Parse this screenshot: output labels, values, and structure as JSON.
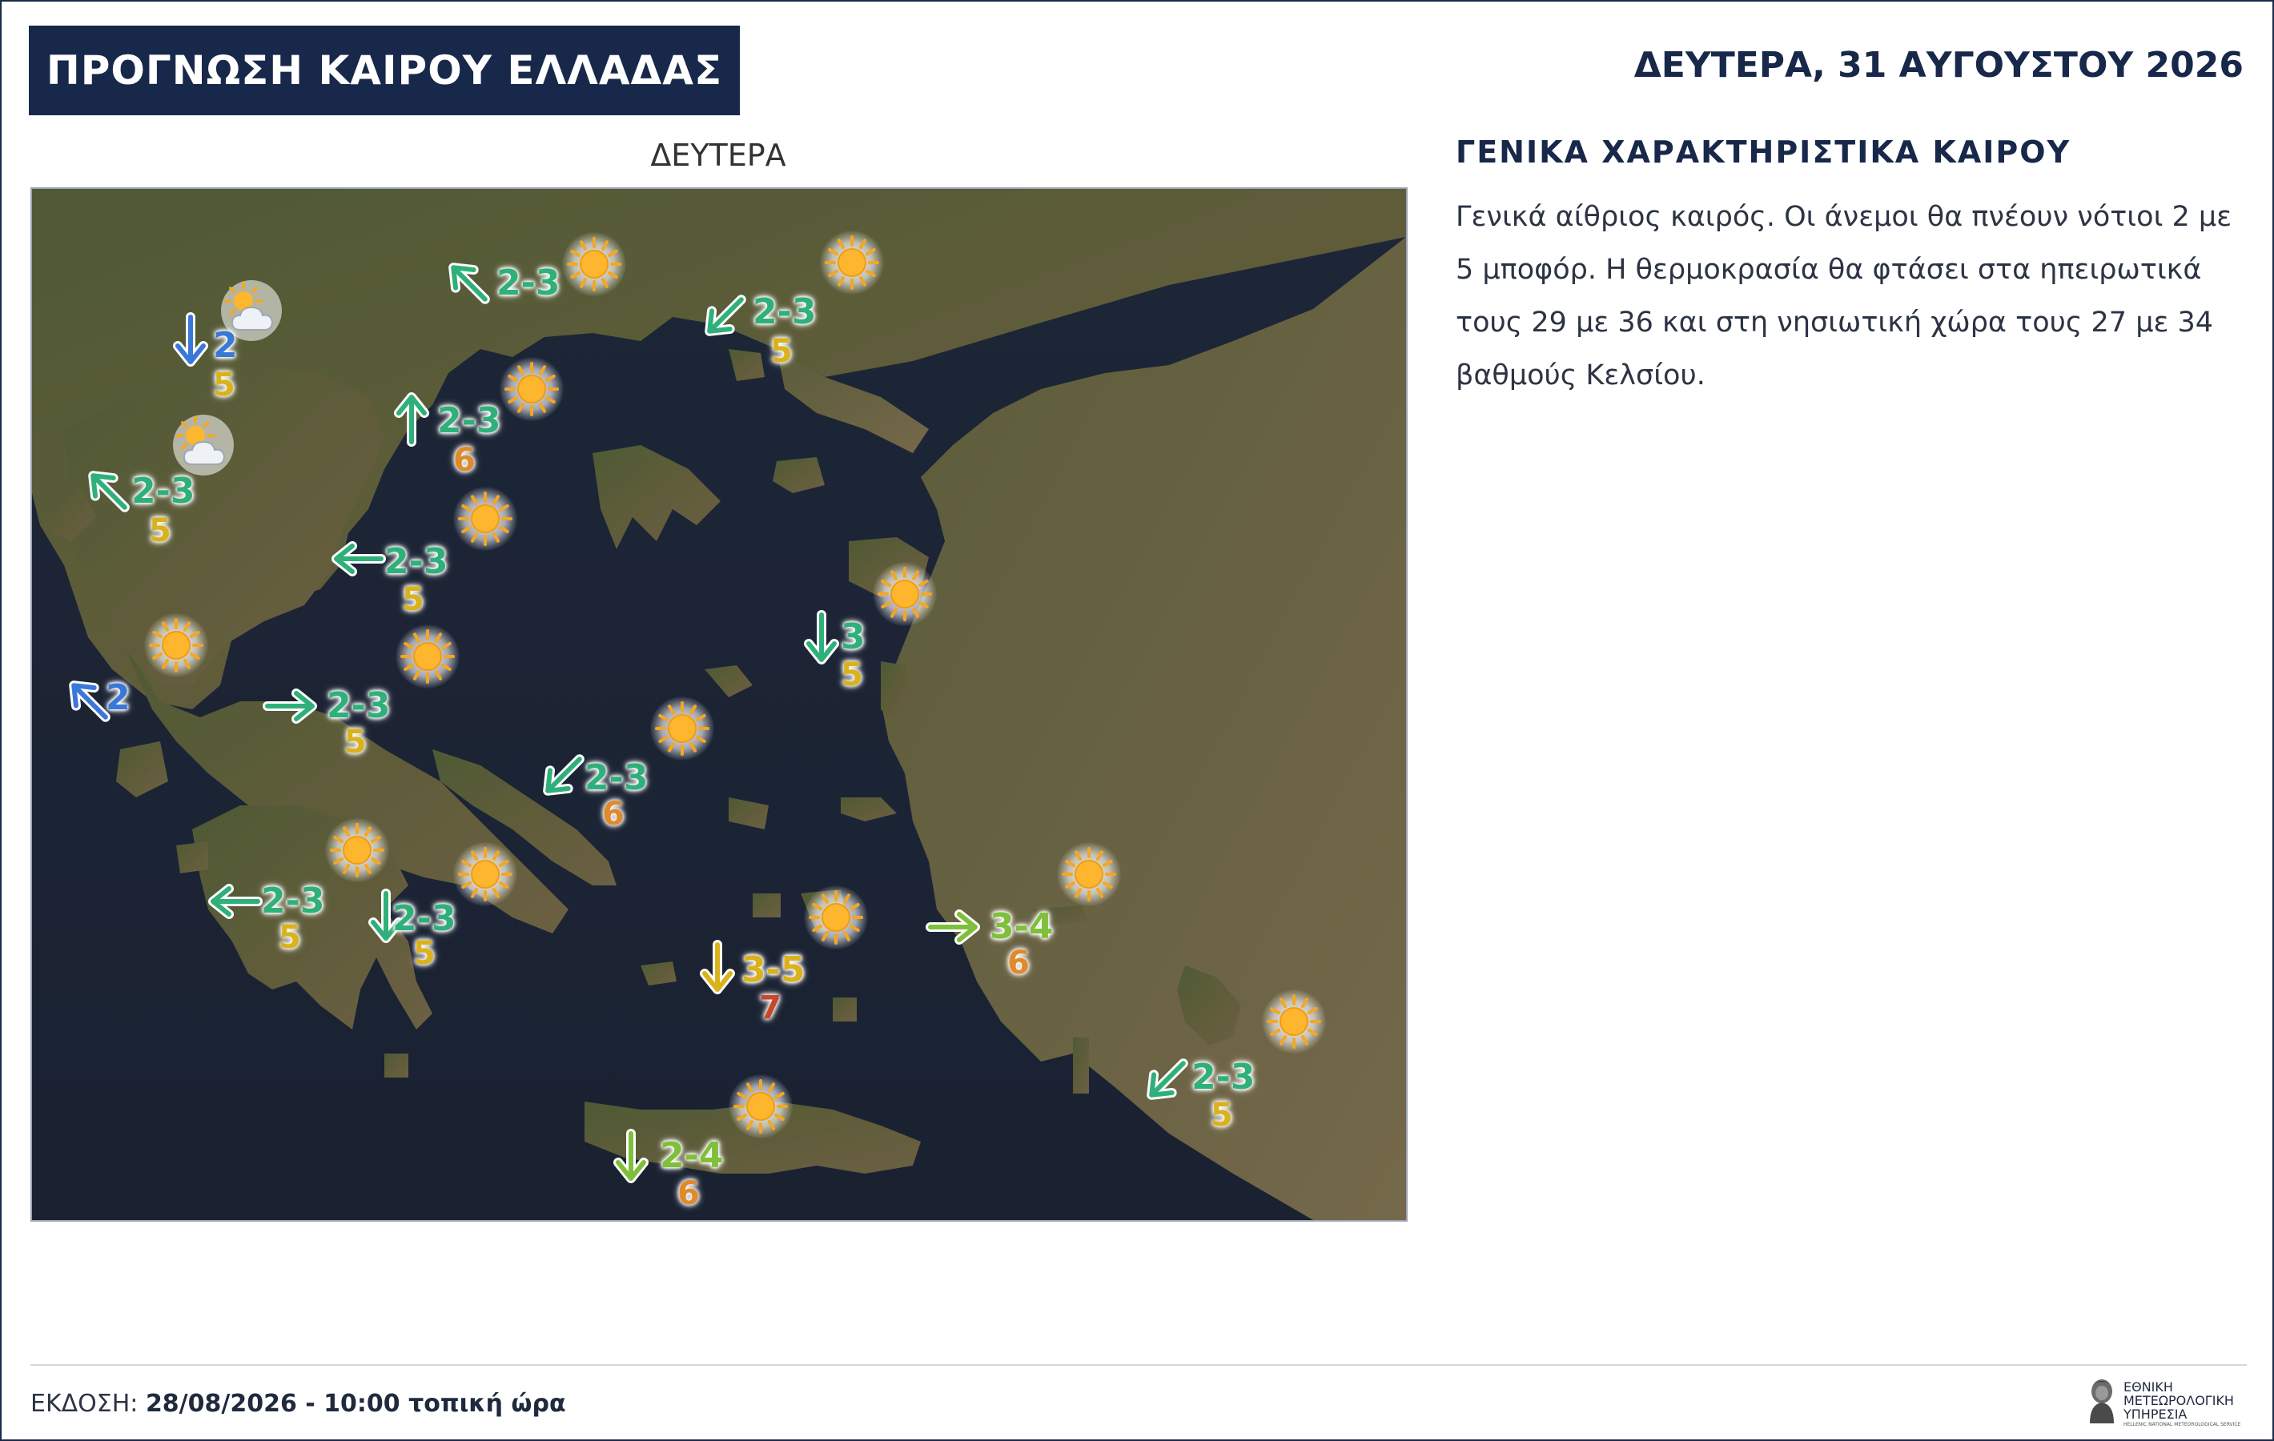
{
  "header": {
    "title": "ΠΡΟΓΝΩΣΗ ΚΑΙΡΟΥ ΕΛΛΑΔΑΣ",
    "date": "ΔΕΥΤΕΡΑ, 31 ΑΥΓΟΥΣΤΟΥ 2026"
  },
  "map": {
    "label": "ΔΕΥΤΕΡΑ",
    "colors": {
      "wind_green": "#2fb07a",
      "wind_blue": "#3a78d8",
      "wind_lime": "#7fbf3a",
      "wind_yellow": "#d9b21c",
      "temp_5": "#d9b21c",
      "temp_6": "#e08a2a",
      "temp_7": "#c9472a"
    },
    "stations": [
      {
        "weather": "sun-icon",
        "wind_dir": "NW",
        "wind_color": "#2fb07a",
        "beaufort": "2-3",
        "temp": ""
      },
      {
        "weather": "sun-icon",
        "wind_dir": "SW",
        "wind_color": "#2fb07a",
        "beaufort": "2-3",
        "temp": "5"
      },
      {
        "weather": "partly-cloudy-icon",
        "wind_dir": "S",
        "wind_color": "#3a78d8",
        "beaufort": "2",
        "temp": "5"
      },
      {
        "weather": "sun-icon",
        "wind_dir": "N",
        "wind_color": "#2fb07a",
        "beaufort": "2-3",
        "temp": "6"
      },
      {
        "weather": "partly-cloudy-icon",
        "wind_dir": "NW",
        "wind_color": "#2fb07a",
        "beaufort": "2-3",
        "temp": "5"
      },
      {
        "weather": "sun-icon",
        "wind_dir": "W",
        "wind_color": "#2fb07a",
        "beaufort": "2-3",
        "temp": "5"
      },
      {
        "weather": "sun-icon",
        "wind_dir": "S",
        "wind_color": "#2fb07a",
        "beaufort": "3",
        "temp": "5"
      },
      {
        "weather": "sun-icon",
        "wind_dir": "NW",
        "wind_color": "#3a78d8",
        "beaufort": "2",
        "temp": ""
      },
      {
        "weather": "sun-icon",
        "wind_dir": "E",
        "wind_color": "#2fb07a",
        "beaufort": "2-3",
        "temp": "5"
      },
      {
        "weather": "sun-icon",
        "wind_dir": "SW",
        "wind_color": "#2fb07a",
        "beaufort": "2-3",
        "temp": "6"
      },
      {
        "weather": "sun-icon",
        "wind_dir": "W",
        "wind_color": "#2fb07a",
        "beaufort": "2-3",
        "temp": "5"
      },
      {
        "weather": "sun-icon",
        "wind_dir": "S",
        "wind_color": "#2fb07a",
        "beaufort": "2-3",
        "temp": "5"
      },
      {
        "weather": "sun-icon",
        "wind_dir": "S",
        "wind_color": "#d9b21c",
        "beaufort": "3-5",
        "temp": "7"
      },
      {
        "weather": "sun-icon",
        "wind_dir": "E",
        "wind_color": "#7fbf3a",
        "beaufort": "3-4",
        "temp": "6"
      },
      {
        "weather": "sun-icon",
        "wind_dir": "SW",
        "wind_color": "#2fb07a",
        "beaufort": "2-3",
        "temp": "5"
      },
      {
        "weather": "sun-icon",
        "wind_dir": "S",
        "wind_color": "#7fbf3a",
        "beaufort": "2-4",
        "temp": "6"
      }
    ]
  },
  "general": {
    "heading": "ΓΕΝΙΚΑ ΧΑΡΑΚΤΗΡΙΣΤΙΚΑ ΚΑΙΡΟΥ",
    "text": "Γενικά αίθριος καιρός. Οι άνεμοι θα πνέουν νότιοι 2 με 5 μποφόρ. Η θερμοκρασία θα φτάσει στα ηπειρωτικά τους 29 με 36 και στη νησιωτική χώρα τους 27 με 34 βαθμούς Κελσίου."
  },
  "footer": {
    "issue_label": "ΕΚΔΟΣΗ:",
    "issue_value": "28/08/2026 - 10:00 τοπική ώρα",
    "logo_line1": "ΕΘΝΙΚΗ",
    "logo_line2": "ΜΕΤΕΩΡΟΛΟΓΙΚΗ",
    "logo_line3": "ΥΠΗΡΕΣΙΑ",
    "logo_sub": "HELLENIC NATIONAL METEOROLOGICAL SERVICE"
  }
}
